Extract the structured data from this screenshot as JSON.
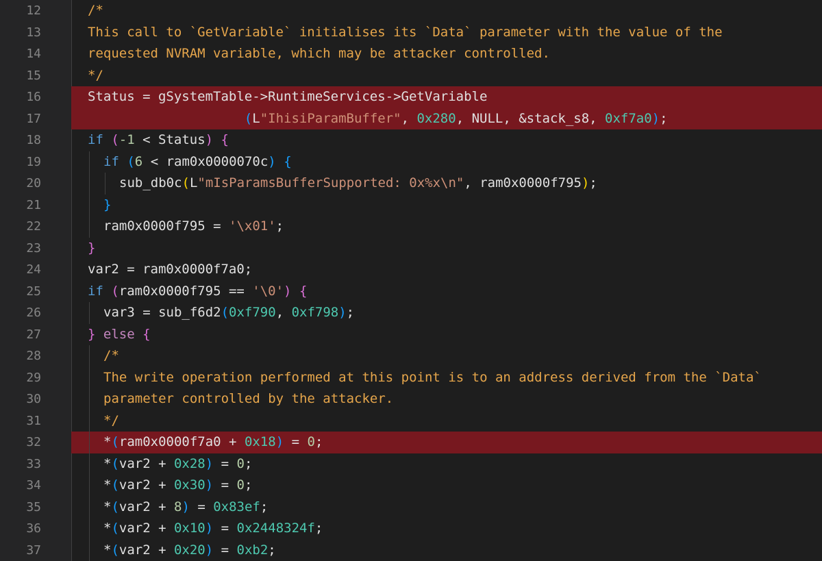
{
  "colors": {
    "background": "#1e1e1e",
    "gutter": "#252526",
    "line_number": "#858585",
    "comment": "#e5a54b",
    "highlight": "#77181f",
    "keyword_purple": "#c586c0",
    "keyword_blue": "#569cd6",
    "hex_number": "#4ec9b0",
    "string": "#ce9178"
  },
  "lines": [
    {
      "number": "12",
      "highlight": false,
      "indent": 0,
      "tokens": [
        {
          "t": "/*",
          "c": "comment"
        }
      ]
    },
    {
      "number": "13",
      "highlight": false,
      "indent": 0,
      "tokens": [
        {
          "t": "This call to `GetVariable` initialises its `Data` parameter with the value of the",
          "c": "comment"
        }
      ]
    },
    {
      "number": "14",
      "highlight": false,
      "indent": 0,
      "tokens": [
        {
          "t": "requested NVRAM variable, which may be attacker controlled.",
          "c": "comment"
        }
      ]
    },
    {
      "number": "15",
      "highlight": false,
      "indent": 0,
      "tokens": [
        {
          "t": "*/",
          "c": "comment"
        }
      ]
    },
    {
      "number": "16",
      "highlight": true,
      "indent": 0,
      "tokens": [
        {
          "t": "Status = gSystemTable->RuntimeServices->GetVariable",
          "c": "plain"
        }
      ]
    },
    {
      "number": "17",
      "highlight": true,
      "indent": 0,
      "tokens": [
        {
          "t": "                    ",
          "c": "plain"
        },
        {
          "t": "(",
          "c": "paren-blue"
        },
        {
          "t": "L",
          "c": "plain"
        },
        {
          "t": "\"IhisiParamBuffer\"",
          "c": "string"
        },
        {
          "t": ", ",
          "c": "plain"
        },
        {
          "t": "0x280",
          "c": "num"
        },
        {
          "t": ", NULL, &stack_s8, ",
          "c": "plain"
        },
        {
          "t": "0xf7a0",
          "c": "num"
        },
        {
          "t": ")",
          "c": "paren-blue"
        },
        {
          "t": ";",
          "c": "plain"
        }
      ]
    },
    {
      "number": "18",
      "highlight": false,
      "indent": 0,
      "tokens": [
        {
          "t": "if",
          "c": "control"
        },
        {
          "t": " ",
          "c": "plain"
        },
        {
          "t": "(",
          "c": "paren-purple"
        },
        {
          "t": "-1",
          "c": "numeral"
        },
        {
          "t": " < Status",
          "c": "plain"
        },
        {
          "t": ")",
          "c": "paren-purple"
        },
        {
          "t": " ",
          "c": "plain"
        },
        {
          "t": "{",
          "c": "paren-purple"
        }
      ]
    },
    {
      "number": "19",
      "highlight": false,
      "indent": 1,
      "tokens": [
        {
          "t": "if",
          "c": "control"
        },
        {
          "t": " ",
          "c": "plain"
        },
        {
          "t": "(",
          "c": "paren-blue"
        },
        {
          "t": "6",
          "c": "numeral"
        },
        {
          "t": " < ram0x0000070c",
          "c": "plain"
        },
        {
          "t": ")",
          "c": "paren-blue"
        },
        {
          "t": " ",
          "c": "plain"
        },
        {
          "t": "{",
          "c": "paren-blue"
        }
      ]
    },
    {
      "number": "20",
      "highlight": false,
      "indent": 2,
      "tokens": [
        {
          "t": "sub_db0c",
          "c": "plain"
        },
        {
          "t": "(",
          "c": "paren-gold"
        },
        {
          "t": "L",
          "c": "plain"
        },
        {
          "t": "\"mIsParamsBufferSupported: 0x%x\\n\"",
          "c": "string"
        },
        {
          "t": ", ram0x0000f795",
          "c": "plain"
        },
        {
          "t": ")",
          "c": "paren-gold"
        },
        {
          "t": ";",
          "c": "plain"
        }
      ]
    },
    {
      "number": "21",
      "highlight": false,
      "indent": 1,
      "tokens": [
        {
          "t": "}",
          "c": "paren-blue"
        }
      ]
    },
    {
      "number": "22",
      "highlight": false,
      "indent": 1,
      "tokens": [
        {
          "t": "ram0x0000f795 = ",
          "c": "plain"
        },
        {
          "t": "'\\x01'",
          "c": "string"
        },
        {
          "t": ";",
          "c": "plain"
        }
      ]
    },
    {
      "number": "23",
      "highlight": false,
      "indent": 0,
      "tokens": [
        {
          "t": "}",
          "c": "paren-purple"
        }
      ]
    },
    {
      "number": "24",
      "highlight": false,
      "indent": 0,
      "tokens": [
        {
          "t": "var2 = ram0x0000f7a0;",
          "c": "plain"
        }
      ]
    },
    {
      "number": "25",
      "highlight": false,
      "indent": 0,
      "tokens": [
        {
          "t": "if",
          "c": "control"
        },
        {
          "t": " ",
          "c": "plain"
        },
        {
          "t": "(",
          "c": "paren-purple"
        },
        {
          "t": "ram0x0000f795 == ",
          "c": "plain"
        },
        {
          "t": "'\\0'",
          "c": "string"
        },
        {
          "t": ")",
          "c": "paren-purple"
        },
        {
          "t": " ",
          "c": "plain"
        },
        {
          "t": "{",
          "c": "paren-purple"
        }
      ]
    },
    {
      "number": "26",
      "highlight": false,
      "indent": 1,
      "tokens": [
        {
          "t": "var3 = sub_f6d2",
          "c": "plain"
        },
        {
          "t": "(",
          "c": "paren-blue"
        },
        {
          "t": "0xf790",
          "c": "num"
        },
        {
          "t": ", ",
          "c": "plain"
        },
        {
          "t": "0xf798",
          "c": "num"
        },
        {
          "t": ")",
          "c": "paren-blue"
        },
        {
          "t": ";",
          "c": "plain"
        }
      ]
    },
    {
      "number": "27",
      "highlight": false,
      "indent": 0,
      "tokens": [
        {
          "t": "}",
          "c": "paren-purple"
        },
        {
          "t": " ",
          "c": "plain"
        },
        {
          "t": "else",
          "c": "keyword"
        },
        {
          "t": " ",
          "c": "plain"
        },
        {
          "t": "{",
          "c": "paren-purple"
        }
      ]
    },
    {
      "number": "28",
      "highlight": false,
      "indent": 1,
      "tokens": [
        {
          "t": "/*",
          "c": "comment"
        }
      ]
    },
    {
      "number": "29",
      "highlight": false,
      "indent": 1,
      "tokens": [
        {
          "t": "The write operation performed at this point is to an address derived from the `Data`",
          "c": "comment"
        }
      ]
    },
    {
      "number": "30",
      "highlight": false,
      "indent": 1,
      "tokens": [
        {
          "t": "parameter controlled by the attacker.",
          "c": "comment"
        }
      ]
    },
    {
      "number": "31",
      "highlight": false,
      "indent": 1,
      "tokens": [
        {
          "t": "*/",
          "c": "comment"
        }
      ]
    },
    {
      "number": "32",
      "highlight": true,
      "indent": 1,
      "tokens": [
        {
          "t": "*",
          "c": "plain"
        },
        {
          "t": "(",
          "c": "paren-blue"
        },
        {
          "t": "ram0x0000f7a0 + ",
          "c": "plain"
        },
        {
          "t": "0x18",
          "c": "num"
        },
        {
          "t": ")",
          "c": "paren-blue"
        },
        {
          "t": " = ",
          "c": "plain"
        },
        {
          "t": "0",
          "c": "numeral"
        },
        {
          "t": ";",
          "c": "plain"
        }
      ]
    },
    {
      "number": "33",
      "highlight": false,
      "indent": 1,
      "tokens": [
        {
          "t": "*",
          "c": "plain"
        },
        {
          "t": "(",
          "c": "paren-blue"
        },
        {
          "t": "var2 + ",
          "c": "plain"
        },
        {
          "t": "0x28",
          "c": "num"
        },
        {
          "t": ")",
          "c": "paren-blue"
        },
        {
          "t": " = ",
          "c": "plain"
        },
        {
          "t": "0",
          "c": "numeral"
        },
        {
          "t": ";",
          "c": "plain"
        }
      ]
    },
    {
      "number": "34",
      "highlight": false,
      "indent": 1,
      "tokens": [
        {
          "t": "*",
          "c": "plain"
        },
        {
          "t": "(",
          "c": "paren-blue"
        },
        {
          "t": "var2 + ",
          "c": "plain"
        },
        {
          "t": "0x30",
          "c": "num"
        },
        {
          "t": ")",
          "c": "paren-blue"
        },
        {
          "t": " = ",
          "c": "plain"
        },
        {
          "t": "0",
          "c": "numeral"
        },
        {
          "t": ";",
          "c": "plain"
        }
      ]
    },
    {
      "number": "35",
      "highlight": false,
      "indent": 1,
      "tokens": [
        {
          "t": "*",
          "c": "plain"
        },
        {
          "t": "(",
          "c": "paren-blue"
        },
        {
          "t": "var2 + ",
          "c": "plain"
        },
        {
          "t": "8",
          "c": "numeral"
        },
        {
          "t": ")",
          "c": "paren-blue"
        },
        {
          "t": " = ",
          "c": "plain"
        },
        {
          "t": "0x83ef",
          "c": "num"
        },
        {
          "t": ";",
          "c": "plain"
        }
      ]
    },
    {
      "number": "36",
      "highlight": false,
      "indent": 1,
      "tokens": [
        {
          "t": "*",
          "c": "plain"
        },
        {
          "t": "(",
          "c": "paren-blue"
        },
        {
          "t": "var2 + ",
          "c": "plain"
        },
        {
          "t": "0x10",
          "c": "num"
        },
        {
          "t": ")",
          "c": "paren-blue"
        },
        {
          "t": " = ",
          "c": "plain"
        },
        {
          "t": "0x2448324f",
          "c": "num"
        },
        {
          "t": ";",
          "c": "plain"
        }
      ]
    },
    {
      "number": "37",
      "highlight": false,
      "indent": 1,
      "tokens": [
        {
          "t": "*",
          "c": "plain"
        },
        {
          "t": "(",
          "c": "paren-blue"
        },
        {
          "t": "var2 + ",
          "c": "plain"
        },
        {
          "t": "0x20",
          "c": "num"
        },
        {
          "t": ")",
          "c": "paren-blue"
        },
        {
          "t": " = ",
          "c": "plain"
        },
        {
          "t": "0xb2",
          "c": "num"
        },
        {
          "t": ";",
          "c": "plain"
        }
      ]
    }
  ]
}
